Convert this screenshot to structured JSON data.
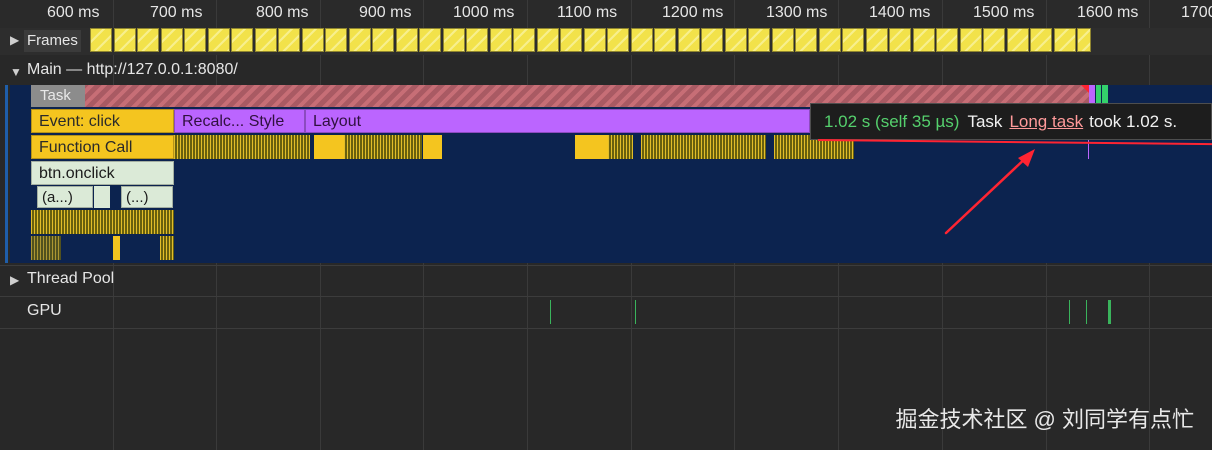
{
  "timeline": {
    "ruler_labels": [
      "600 ms",
      "700 ms",
      "800 ms",
      "900 ms",
      "1000 ms",
      "1100 ms",
      "1200 ms",
      "1300 ms",
      "1400 ms",
      "1500 ms",
      "1600 ms",
      "1700 ms"
    ]
  },
  "tracks": {
    "frames": "Frames",
    "main": "Main — http://127.0.0.1:8080/",
    "thread_pool": "Thread Pool",
    "gpu": "GPU"
  },
  "events": {
    "task": "Task",
    "event_click": "Event: click",
    "recalc_style": "Recalc... Style",
    "layout": "Layout",
    "function_call": "Function Call",
    "btn_onclick": "btn.onclick",
    "anonymous_1": "(a...)",
    "anonymous_2": "(...)"
  },
  "tooltip": {
    "time": "1.02 s (self 35 µs)",
    "task": "Task",
    "link": "Long task",
    "rest": "took 1.02 s."
  },
  "watermark": "掘金技术社区 @ 刘同学有点忙",
  "colors": {
    "background": "#282828",
    "flame_background": "#0c234f",
    "frame_yellow": "#f2e24a",
    "scripting_yellow": "#f4c51f",
    "rendering_purple": "#bb65ff",
    "long_task_red": "#c76e76",
    "tooltip_time_green": "#55d06d",
    "annotation_red": "#ff2432"
  },
  "icons": [
    "expand-triangle-icon",
    "collapse-triangle-icon",
    "long-task-warning-icon"
  ]
}
